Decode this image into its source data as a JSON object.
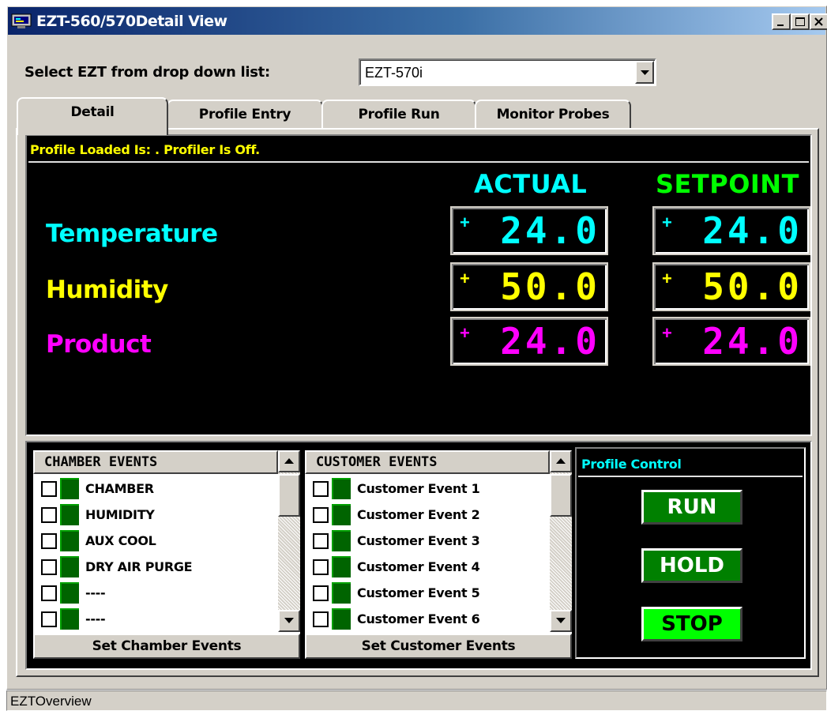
{
  "window": {
    "title": "EZT-560/570Detail View",
    "icon": "monitor-app-icon"
  },
  "selector": {
    "label": "Select EZT from drop down list:",
    "value": "EZT-570i"
  },
  "tabs": [
    {
      "label": "Detail",
      "active": true
    },
    {
      "label": "Profile Entry",
      "active": false
    },
    {
      "label": "Profile Run",
      "active": false
    },
    {
      "label": "Monitor Probes",
      "active": false
    }
  ],
  "detail": {
    "status": "Profile Loaded Is: . Profiler Is Off.",
    "actual_header": "ACTUAL",
    "setpoint_header": "SETPOINT",
    "rows": [
      {
        "label": "Temperature",
        "sign": "+",
        "actual": "24.0",
        "setpoint": "24.0",
        "color": "#00ffff"
      },
      {
        "label": "Humidity",
        "sign": "+",
        "actual": "50.0",
        "setpoint": "50.0",
        "color": "#ffff00"
      },
      {
        "label": "Product",
        "sign": "+",
        "actual": "24.0",
        "setpoint": "24.0",
        "color": "#ff00ff"
      }
    ]
  },
  "chamber_events": {
    "header": "CHAMBER EVENTS",
    "items": [
      "CHAMBER",
      "HUMIDITY",
      "AUX COOL",
      "DRY AIR PURGE",
      "----",
      "----"
    ],
    "button": "Set Chamber Events"
  },
  "customer_events": {
    "header": "CUSTOMER EVENTS",
    "items": [
      "Customer Event 1",
      "Customer Event 2",
      "Customer Event 3",
      "Customer Event 4",
      "Customer Event 5",
      "Customer Event 6"
    ],
    "button": "Set Customer Events"
  },
  "profile_control": {
    "title": "Profile Control",
    "run": "RUN",
    "hold": "HOLD",
    "stop": "STOP"
  },
  "statusbar": {
    "text": "EZTOverview"
  },
  "colors": {
    "actual_header": "#00ffff",
    "setpoint_header": "#00ff00",
    "status_text": "#ffff00",
    "titlebar": "#0a246a",
    "led": "#006400"
  }
}
